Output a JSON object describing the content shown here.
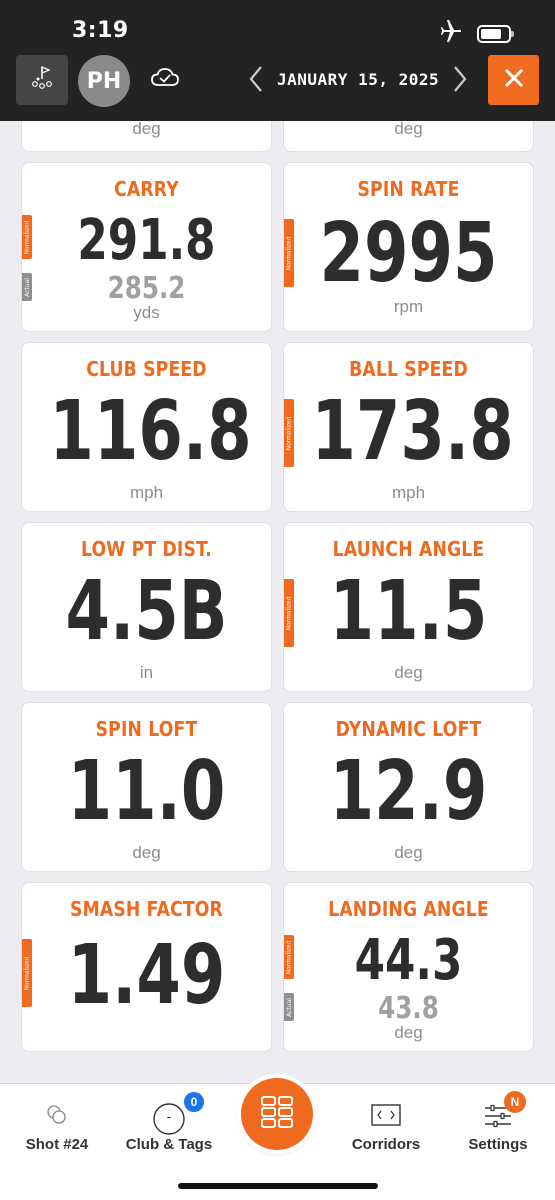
{
  "status_bar": {
    "time": "3:19"
  },
  "header": {
    "avatar_initials": "PH",
    "date": "JANUARY 15, 2025"
  },
  "tags": {
    "normalized": "Normalized",
    "actual": "Actual"
  },
  "partial_row": {
    "left_unit": "deg",
    "right_unit": "deg"
  },
  "metrics": {
    "carry": {
      "title": "CARRY",
      "value": "291.8",
      "actual": "285.2",
      "unit": "yds"
    },
    "spin_rate": {
      "title": "SPIN RATE",
      "value": "2995",
      "unit": "rpm"
    },
    "club_speed": {
      "title": "CLUB SPEED",
      "value": "116.8",
      "unit": "mph"
    },
    "ball_speed": {
      "title": "BALL SPEED",
      "value": "173.8",
      "unit": "mph"
    },
    "low_pt_dist": {
      "title": "LOW PT DIST.",
      "value": "4.5B",
      "unit": "in"
    },
    "launch_angle": {
      "title": "LAUNCH ANGLE",
      "value": "11.5",
      "unit": "deg"
    },
    "spin_loft": {
      "title": "SPIN LOFT",
      "value": "11.0",
      "unit": "deg"
    },
    "dynamic_loft": {
      "title": "DYNAMIC LOFT",
      "value": "12.9",
      "unit": "deg"
    },
    "smash_factor": {
      "title": "SMASH FACTOR",
      "value": "1.49",
      "unit": ""
    },
    "landing_angle": {
      "title": "LANDING ANGLE",
      "value": "44.3",
      "actual": "43.8",
      "unit": "deg"
    }
  },
  "bottom_nav": {
    "shot": "Shot #24",
    "club_tags": "Club & Tags",
    "club_tags_badge": "0",
    "club_icon_text": "-",
    "corridors": "Corridors",
    "settings": "Settings",
    "settings_badge": "N"
  },
  "colors": {
    "accent": "#ef6a1f",
    "dark_bar": "#232323",
    "badge_blue": "#1b74e8"
  },
  "icons": [
    "course-icon",
    "cloud-check-icon",
    "chevron-left-icon",
    "chevron-right-icon",
    "close-icon",
    "balls-icon",
    "grid-icon",
    "corridors-icon",
    "sliders-icon",
    "airplane-icon",
    "battery-icon"
  ]
}
